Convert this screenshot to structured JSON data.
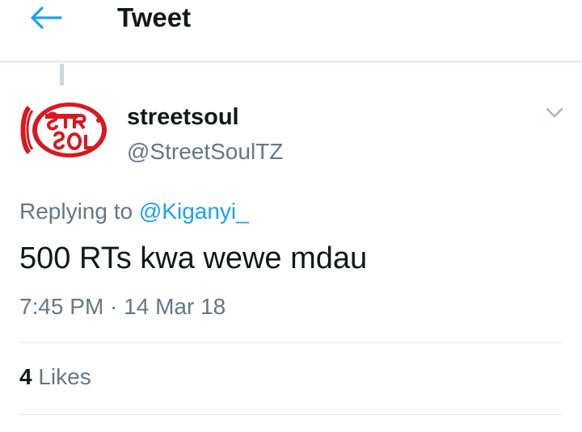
{
  "header": {
    "title": "Tweet",
    "back_icon": "arrow-left-icon"
  },
  "colors": {
    "accent": "#1da1f2",
    "text_primary": "#14171a",
    "text_secondary": "#657786",
    "divider": "#e1e8ed",
    "avatar_red": "#d71920"
  },
  "tweet": {
    "author_name": "streetsoul",
    "author_handle": "@StreetSoulTZ",
    "menu_icon": "chevron-down-icon",
    "reply_prefix": "Replying to",
    "reply_to": "@Kiganyi_",
    "text": "500 RTs kwa wewe mdau",
    "timestamp": "7:45 PM · 14 Mar 18"
  },
  "stats": {
    "likes_count": "4",
    "likes_label": "Likes"
  }
}
